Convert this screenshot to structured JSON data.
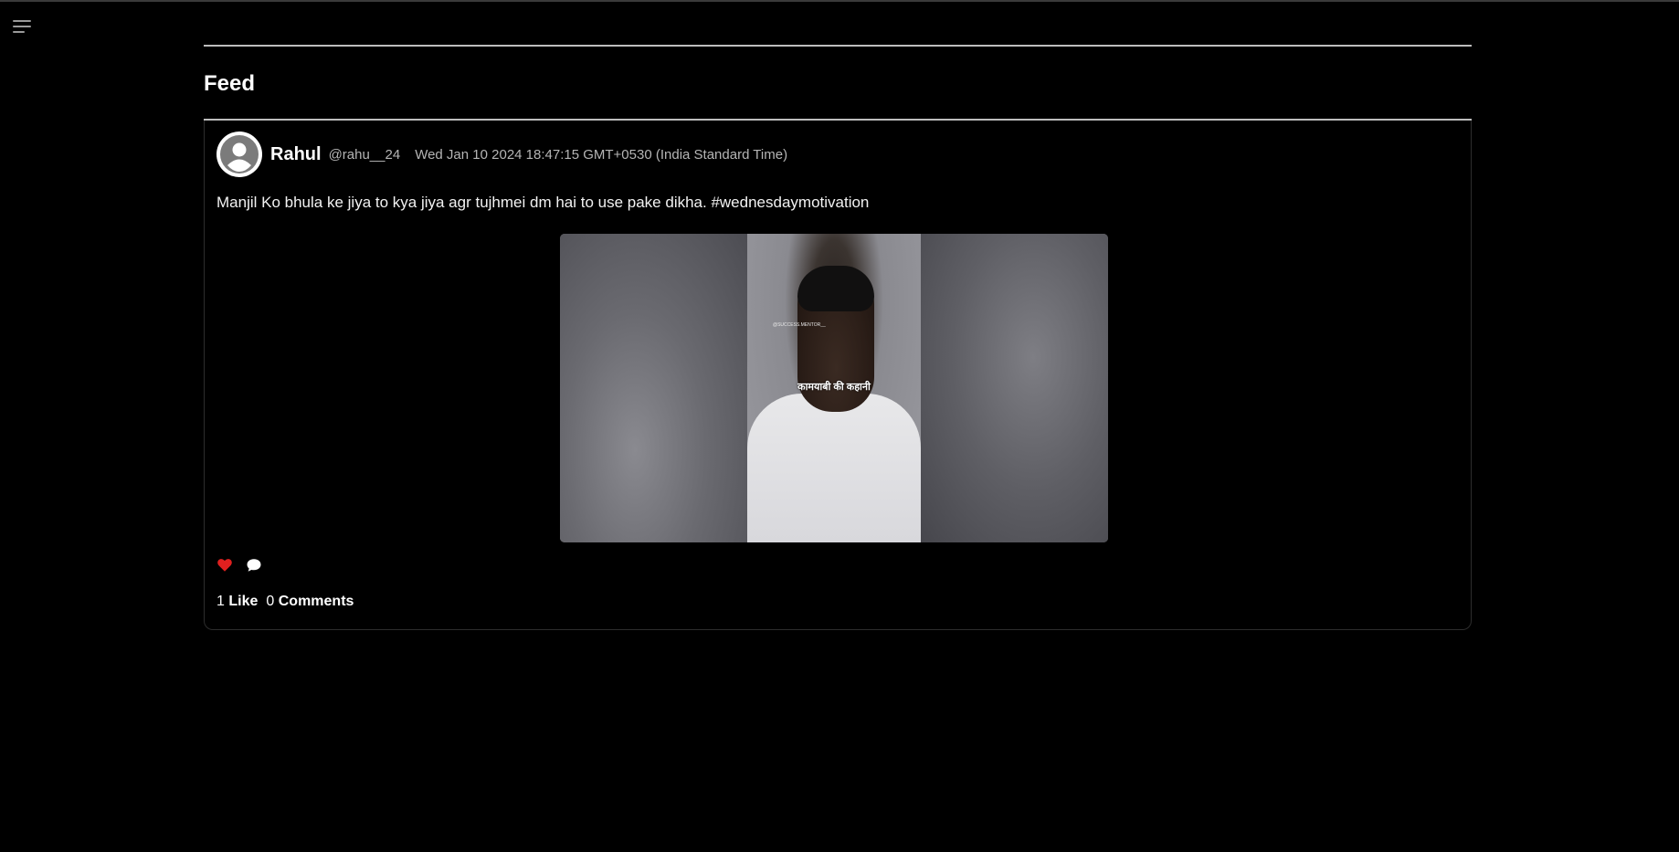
{
  "nav": {
    "menu_icon": "hamburger-menu-icon"
  },
  "feed": {
    "title": "Feed"
  },
  "post": {
    "author_name": "Rahul",
    "author_handle": "@rahu__24",
    "timestamp": "Wed Jan 10 2024 18:47:15 GMT+0530 (India Standard Time)",
    "text": "Manjil Ko bhula ke jiya to kya jiya agr tujhmei dm hai to use pake dikha. #wednesdaymotivation",
    "media": {
      "type": "video-thumbnail",
      "watermark": "@SUCCESS.MENTOR__",
      "caption": "कामयाबी की कहानी"
    },
    "actions": {
      "like_icon": "heart-icon",
      "like_color": "#e0201f",
      "comment_icon": "speech-bubble-icon"
    },
    "stats": {
      "likes_count": "1",
      "likes_label": "Like",
      "comments_count": "0",
      "comments_label": "Comments"
    }
  }
}
